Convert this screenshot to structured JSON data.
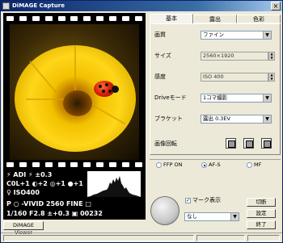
{
  "window": {
    "title": "DiMAGE Capture",
    "close_glyph": "×"
  },
  "preview": {
    "info_lines": [
      "⚡ ADI ⚡ ±0.3",
      "C0L+1 ◐+2 ◎+1 ●+1",
      "♀ ISO400",
      "P ○ -VIVID 2560 FINE □",
      "1/160 F2.8 ±+0.3 ▣ 00232"
    ]
  },
  "tabs": [
    "基本",
    "露出",
    "色彩"
  ],
  "settings": {
    "quality": {
      "label": "画質",
      "value": "ファイン"
    },
    "size": {
      "label": "サイズ",
      "value": "2560×1920"
    },
    "iso": {
      "label": "感度",
      "value": "ISO 400"
    },
    "drive": {
      "label": "Driveモード",
      "value": "1コマ撮影"
    },
    "bracket": {
      "label": "ブラケット",
      "value": "露出 0.3EV"
    },
    "rotate": {
      "label": "画像回転"
    }
  },
  "focus_modes": [
    "FFP ON",
    "AF-S",
    "MF"
  ],
  "mark": {
    "label": "マーク表示",
    "checked": true,
    "value": "なし"
  },
  "buttons": {
    "cut": "切断",
    "settings": "設定",
    "exit": "終了"
  },
  "viewer_button": "DiMAGE Viewer",
  "colors": {
    "titlebar": "#0a246a",
    "face": "#ece9d8"
  }
}
